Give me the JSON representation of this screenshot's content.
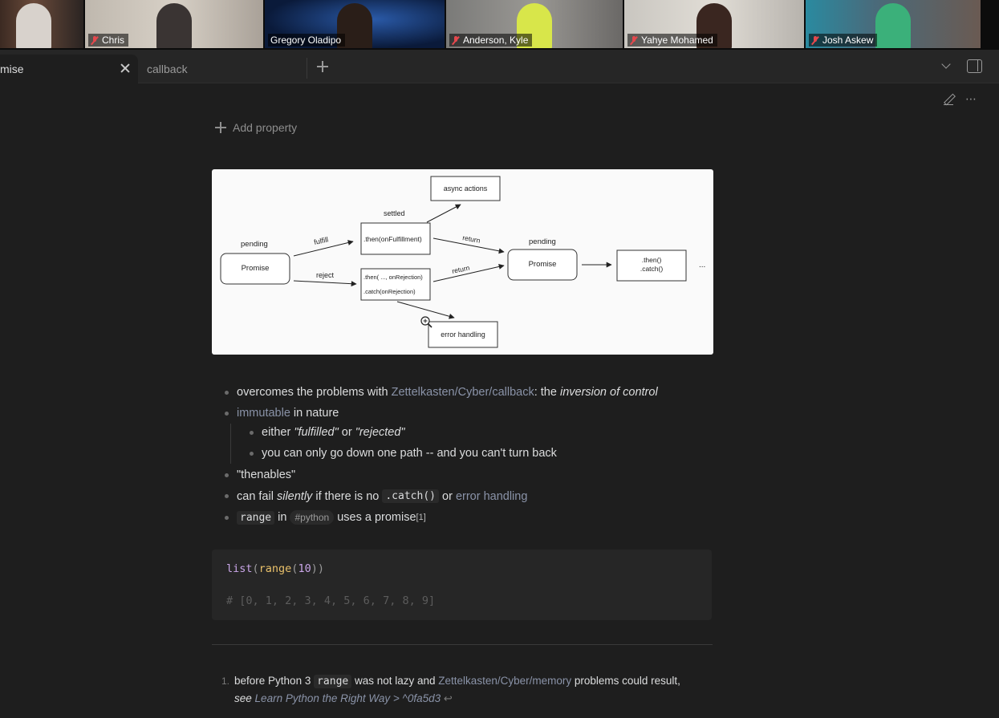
{
  "participants": [
    {
      "name": "",
      "muted": false
    },
    {
      "name": "Chris",
      "muted": true
    },
    {
      "name": "Gregory Oladipo",
      "muted": false
    },
    {
      "name": "Anderson, Kyle",
      "muted": true
    },
    {
      "name": "Yahye Mohamed",
      "muted": true
    },
    {
      "name": "Josh Askew",
      "muted": true
    }
  ],
  "tabs": {
    "active_label": "mise",
    "inactive_label": "callback"
  },
  "note": {
    "add_property": "Add property",
    "diagram": {
      "pending1": "pending",
      "promise1": "Promise",
      "fulfill": "fulfill",
      "reject": "reject",
      "settled": "settled",
      "then_fulfill": ".then(onFulfillment)",
      "then_reject1": ".then( ..., onRejection)",
      "then_reject2": ".catch(onRejection)",
      "async_actions": "async actions",
      "return1": "return",
      "return2": "return",
      "pending2": "pending",
      "promise2": "Promise",
      "then_box1": ".then()",
      "then_box2": ".catch()",
      "ellipsis": "...",
      "error_handling": "error handling"
    },
    "bullets": {
      "b1_pre": "overcomes the problems with ",
      "b1_link": "Zettelkasten/Cyber/callback",
      "b1_mid": ": the ",
      "b1_em": "inversion of control",
      "b2_link": "immutable",
      "b2_post": " in nature",
      "b3_pre": "either ",
      "b3_em1": "\"fulfilled\"",
      "b3_mid": " or ",
      "b3_em2": "\"rejected\"",
      "b4": "you can only go down one path -- and you can't turn back",
      "b5": "\"thenables\"",
      "b6_pre": "can fail ",
      "b6_em": "silently",
      "b6_mid": " if there is no ",
      "b6_code": ".catch()",
      "b6_or": " or ",
      "b6_link": "error handling",
      "b7_code": "range",
      "b7_in": " in ",
      "b7_tag": "#python",
      "b7_post": " uses a promise",
      "b7_sup": "[1]"
    },
    "code": {
      "fn1": "list",
      "fn2": "range",
      "num": "10",
      "comment": "# [0, 1, 2, 3, 4, 5, 6, 7, 8, 9]"
    },
    "footnote": {
      "num": "1.",
      "pre": "before Python 3 ",
      "code": "range",
      "mid": " was not lazy and ",
      "link": "Zettelkasten/Cyber/memory",
      "post": " problems could result,",
      "see": "see",
      "ref": "Learn Python the Right Way > ^0fa5d3",
      "backref": "↩"
    }
  },
  "colors": {
    "bg": "#1e1e1e",
    "link": "#8a93a8",
    "active_speaker": "#3ccf6a",
    "muted_icon": "#e5484d"
  }
}
